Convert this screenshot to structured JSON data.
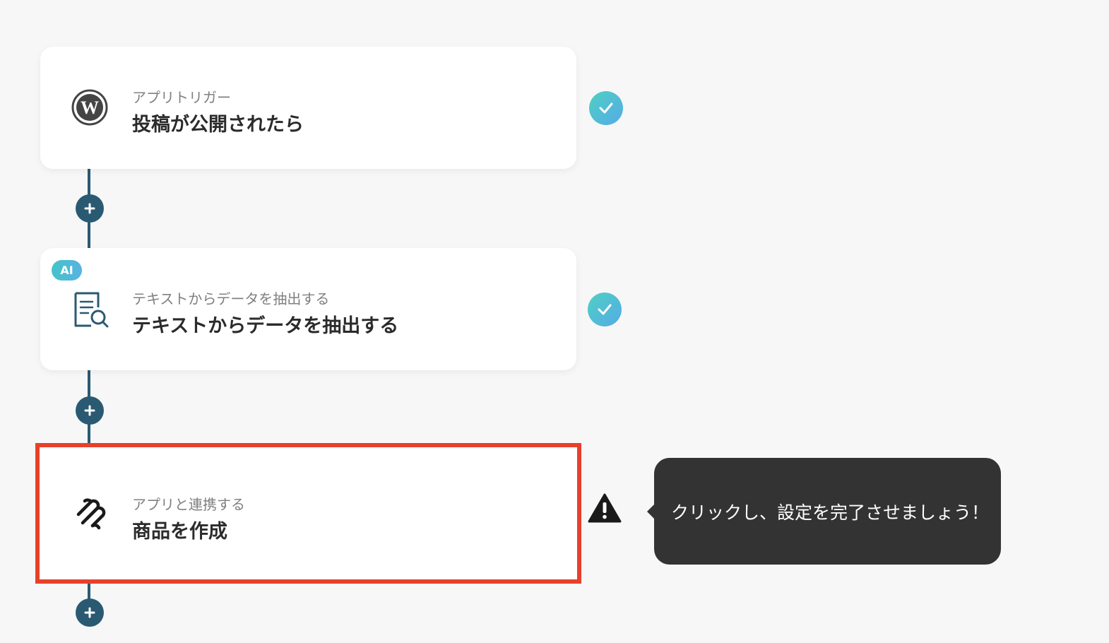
{
  "flow": {
    "steps": [
      {
        "subtitle": "アプリトリガー",
        "title": "投稿が公開されたら",
        "icon": "wordpress-logo-icon",
        "status": "complete",
        "ai": false
      },
      {
        "subtitle": "テキストからデータを抽出する",
        "title": "テキストからデータを抽出する",
        "icon": "document-search-icon",
        "status": "complete",
        "ai": true,
        "badge": "AI"
      },
      {
        "subtitle": "アプリと連携する",
        "title": "商品を作成",
        "icon": "squarespace-logo-icon",
        "status": "warning",
        "ai": false
      }
    ],
    "add_step_buttons": 3
  },
  "tooltip": {
    "text": "クリックし、設定を完了させましょう！"
  },
  "colors": {
    "background": "#f7f7f7",
    "connector": "#2a5a72",
    "check_gradient_start": "#4fd0c4",
    "check_gradient_end": "#55abe6",
    "highlight_border": "#e8402a",
    "tooltip_bg": "#333333"
  }
}
